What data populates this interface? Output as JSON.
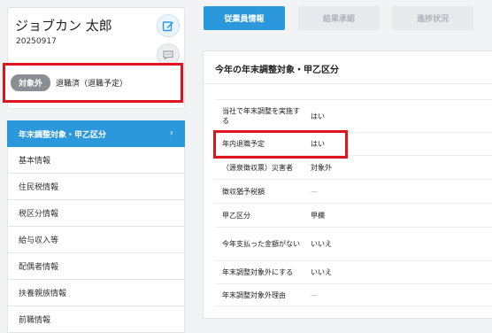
{
  "profile": {
    "name": "ジョブカン 太郎",
    "employee_no": "20250917",
    "status_badge": "対象外",
    "status_text": "退職済（退職予定）"
  },
  "menu": {
    "items": [
      {
        "label": "年末調整対象・甲乙区分",
        "active": true
      },
      {
        "label": "基本情報"
      },
      {
        "label": "住民税情報"
      },
      {
        "label": "税区分情報"
      },
      {
        "label": "給与収入等"
      },
      {
        "label": "配偶者情報"
      },
      {
        "label": "扶養親族情報"
      },
      {
        "label": "前職情報"
      }
    ],
    "chevron": "›"
  },
  "tabs": [
    {
      "label": "従業員情報",
      "active": true
    },
    {
      "label": "結果承認"
    },
    {
      "label": "進捗状況"
    }
  ],
  "section": {
    "title": "今年の年末調整対象・甲乙区分",
    "rows": [
      {
        "label": "当社で年末調整を実施する",
        "value": "はい"
      },
      {
        "label": "年内退職予定",
        "value": "はい"
      },
      {
        "label": "（源泉徴収票）災害者",
        "value": "対象外"
      },
      {
        "label": "徴収猶予税額",
        "value": "—"
      },
      {
        "label": "甲乙区分",
        "value": "甲欄"
      },
      {
        "label": "今年支払った金額がない",
        "value": "いいえ"
      },
      {
        "label": "年末調整対象外にする",
        "value": "いいえ"
      },
      {
        "label": "年末調整対象外理由",
        "value": "—"
      }
    ]
  },
  "icons": {
    "edit": "edit-icon",
    "chat": "chat-icon"
  },
  "colors": {
    "accent": "#2c98dc",
    "highlight": "#e0141e",
    "badge": "#8a8f95"
  }
}
